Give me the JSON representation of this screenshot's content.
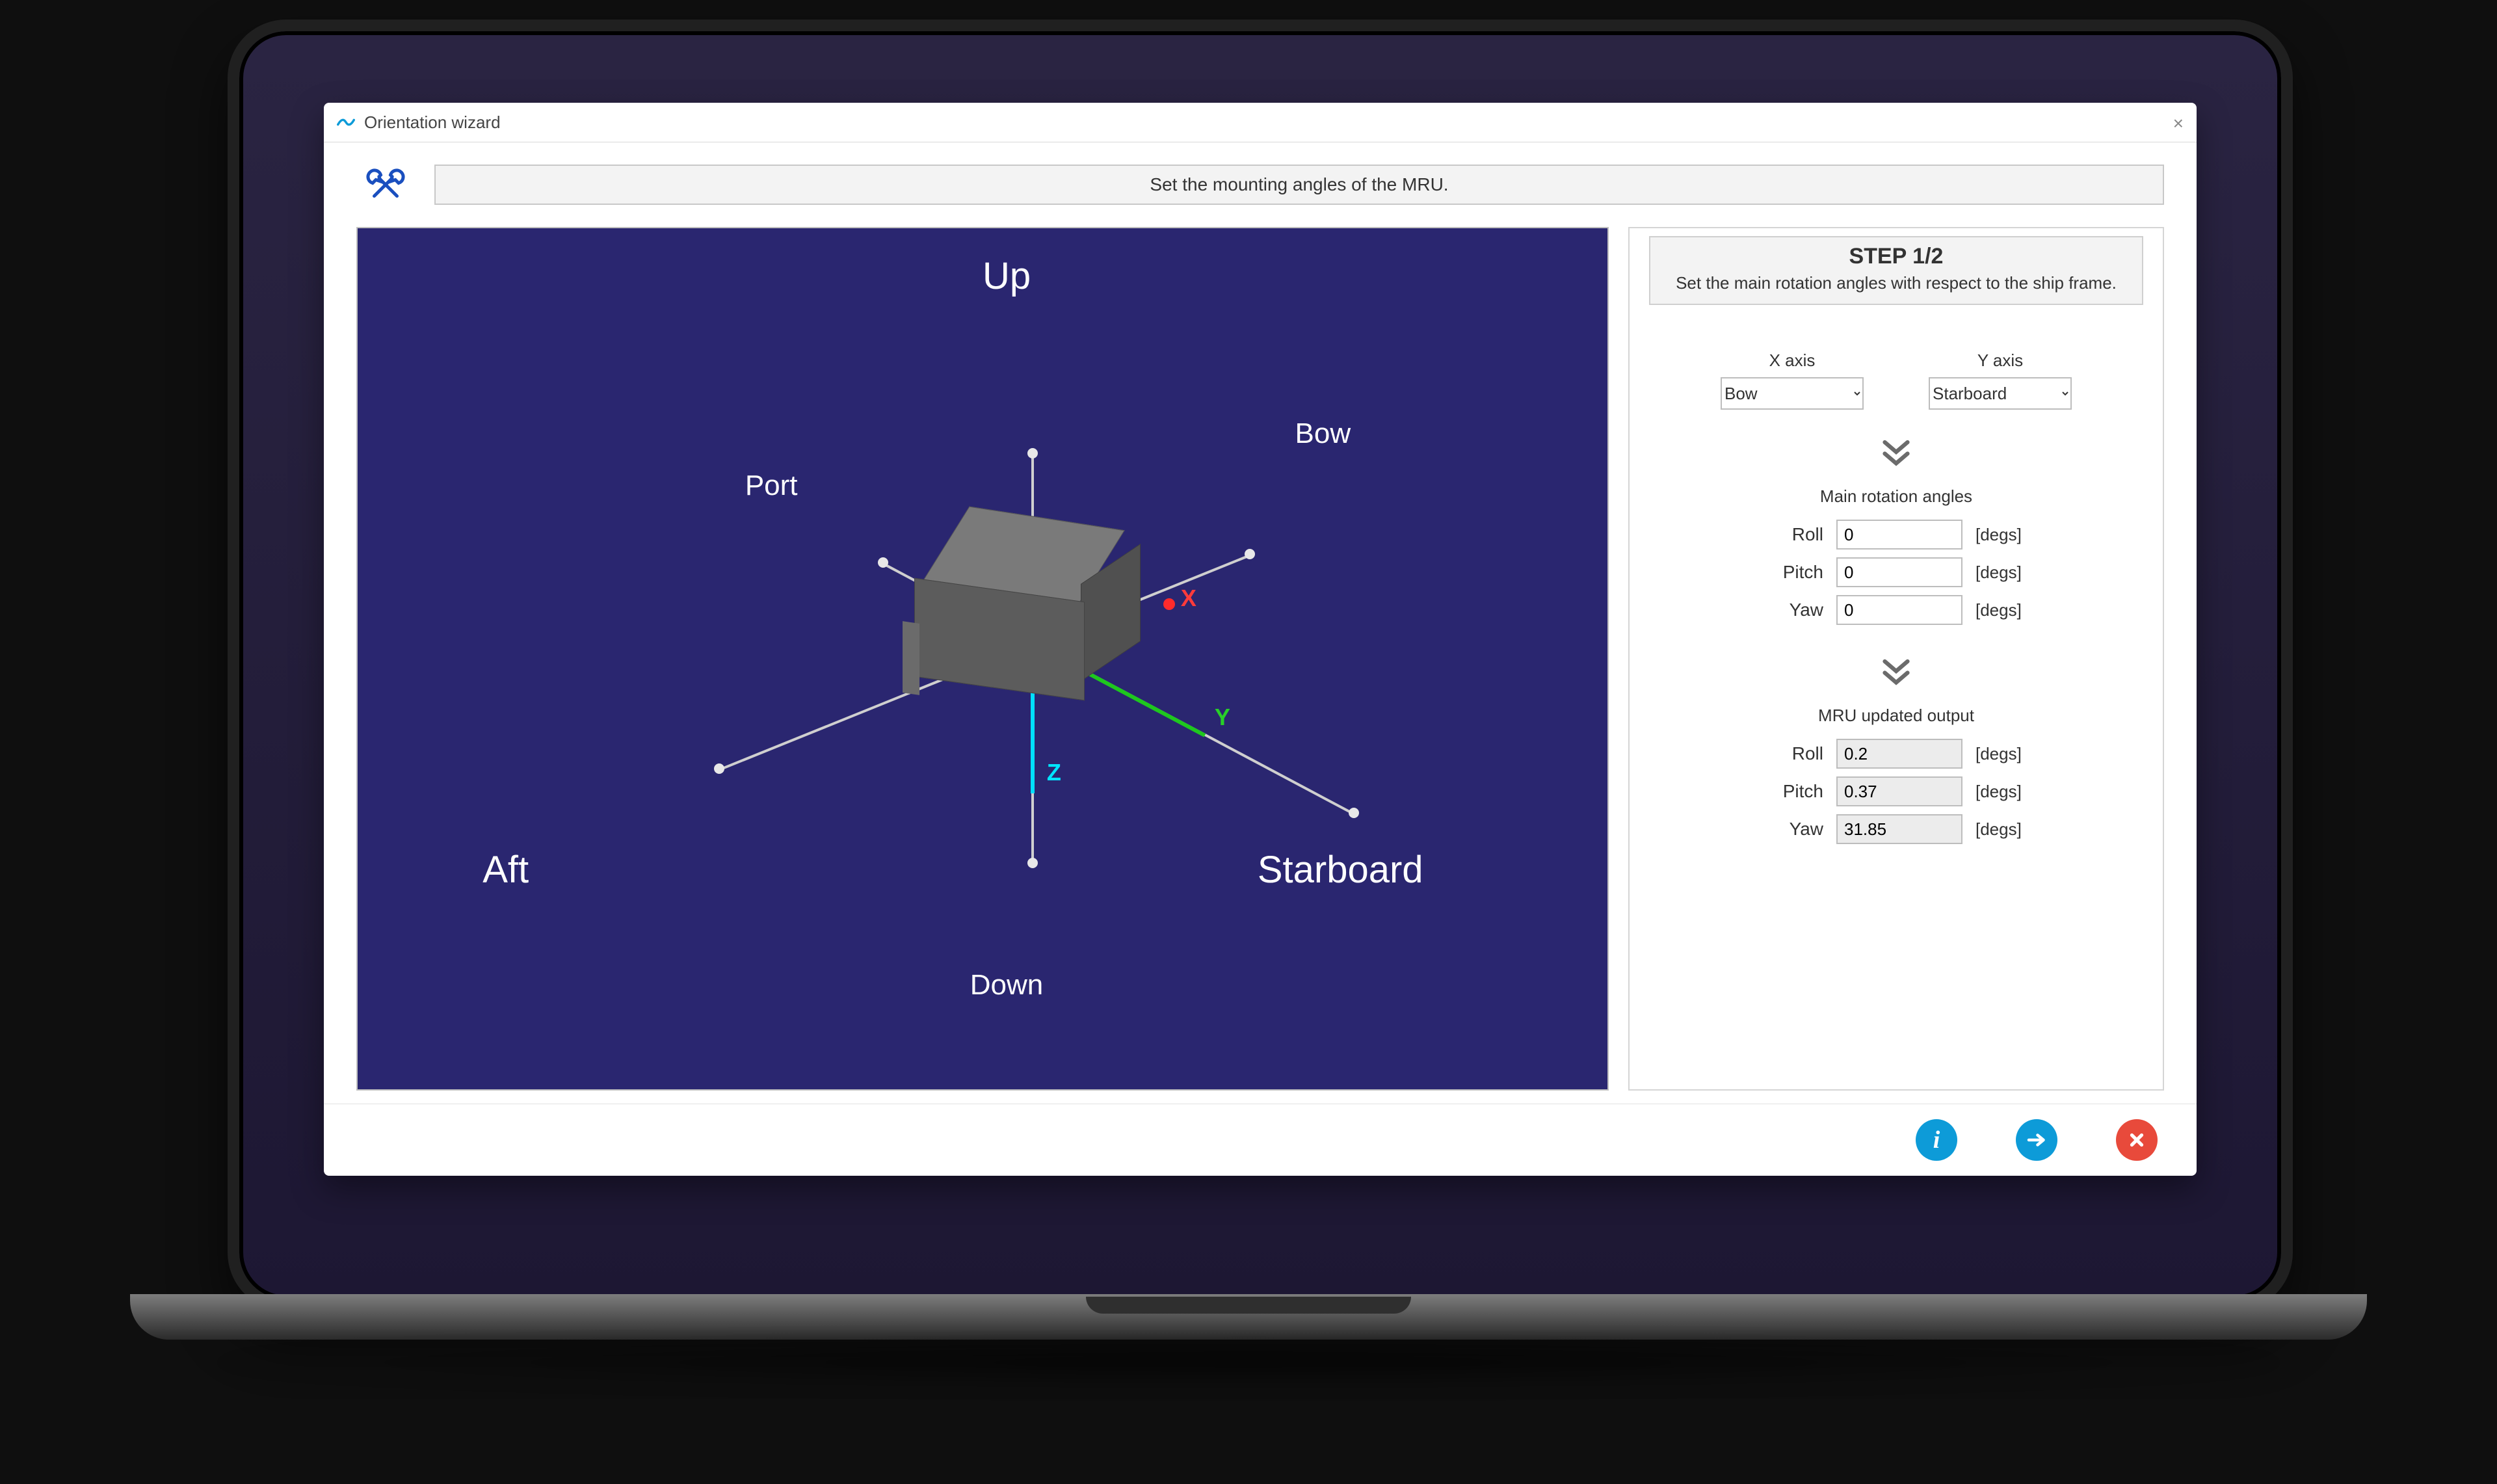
{
  "window": {
    "title": "Orientation wizard"
  },
  "banner": {
    "text": "Set the mounting angles of the MRU."
  },
  "view3d": {
    "labels": {
      "up": "Up",
      "down": "Down",
      "port": "Port",
      "starboard": "Starboard",
      "bow": "Bow",
      "aft": "Aft",
      "x": "X",
      "y": "Y",
      "z": "Z"
    }
  },
  "panel": {
    "step_title": "STEP 1/2",
    "step_desc": "Set the main rotation angles with respect to the ship frame.",
    "x_axis": {
      "label": "X axis",
      "value": "Bow"
    },
    "y_axis": {
      "label": "Y axis",
      "value": "Starboard"
    },
    "main_angles": {
      "title": "Main rotation angles",
      "roll": {
        "label": "Roll",
        "value": "0",
        "unit": "[degs]"
      },
      "pitch": {
        "label": "Pitch",
        "value": "0",
        "unit": "[degs]"
      },
      "yaw": {
        "label": "Yaw",
        "value": "0",
        "unit": "[degs]"
      }
    },
    "output": {
      "title": "MRU updated output",
      "roll": {
        "label": "Roll",
        "value": "0.2",
        "unit": "[degs]"
      },
      "pitch": {
        "label": "Pitch",
        "value": "0.37",
        "unit": "[degs]"
      },
      "yaw": {
        "label": "Yaw",
        "value": "31.85",
        "unit": "[degs]"
      }
    }
  },
  "buttons": {
    "info": "i",
    "next": "→",
    "cancel": "✕"
  }
}
